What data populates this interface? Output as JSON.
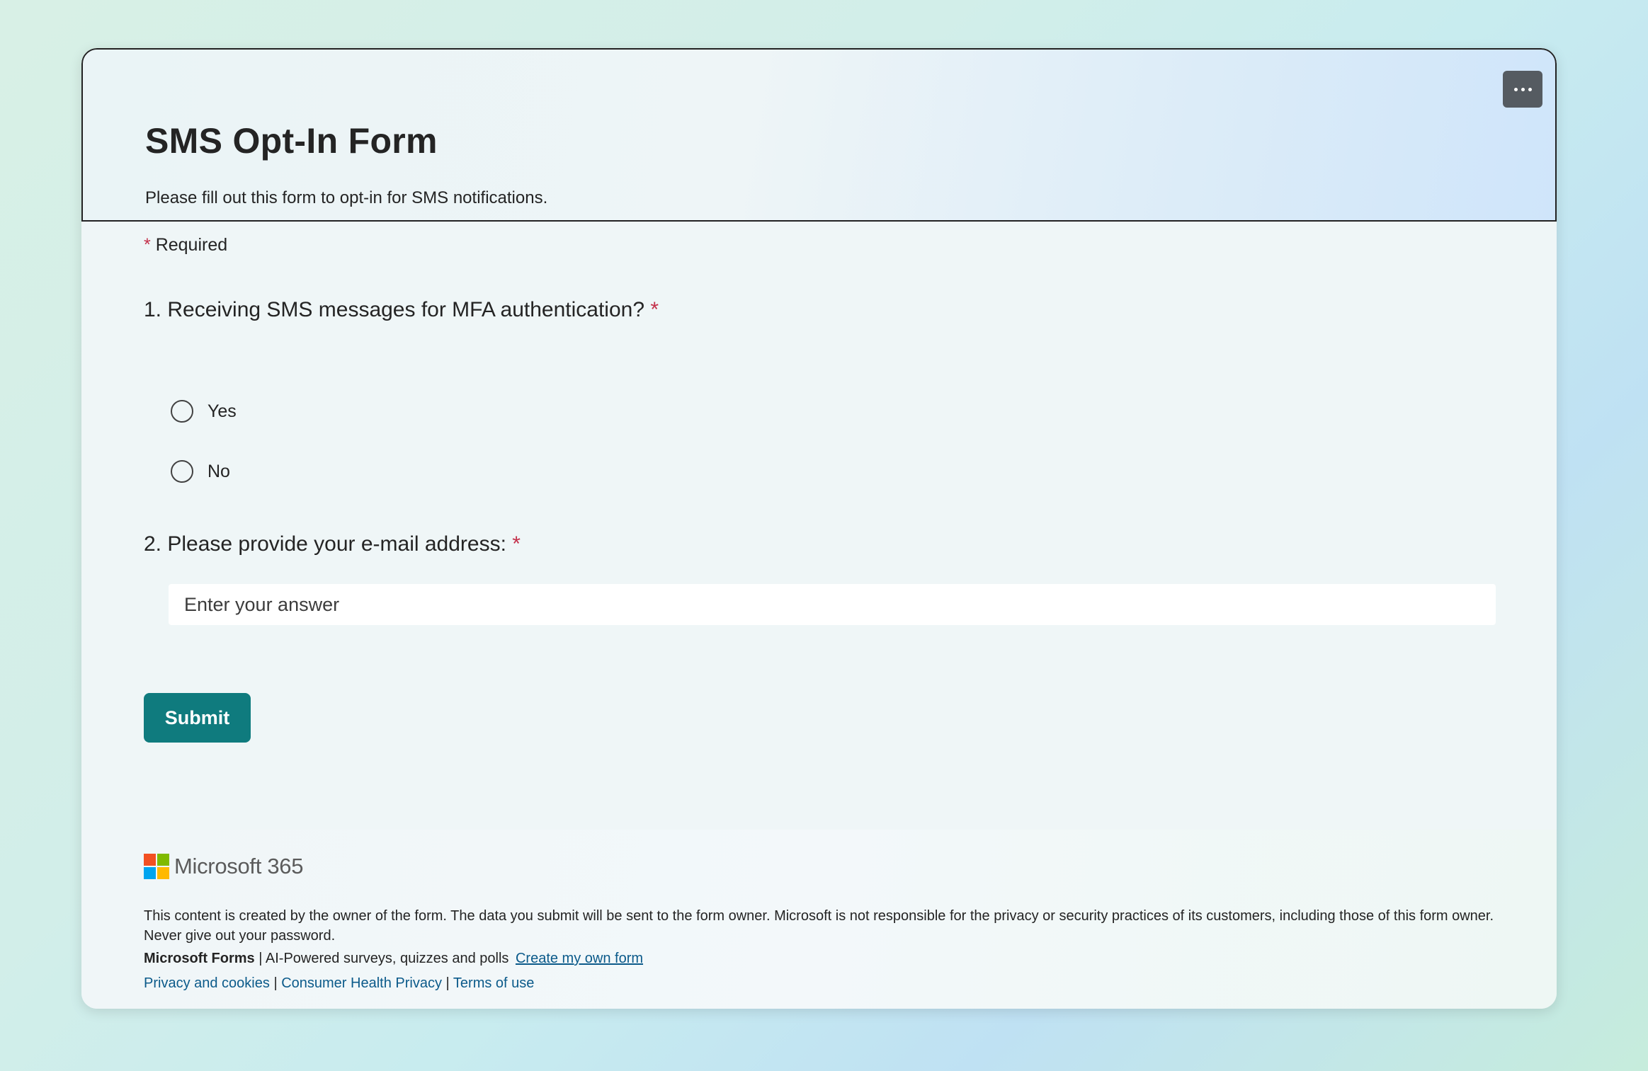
{
  "header": {
    "title": "SMS Opt-In Form",
    "description": "Please fill out this form to opt-in for SMS notifications.",
    "more_icon": "more-horizontal-icon"
  },
  "required_note": {
    "star": "*",
    "label": "Required"
  },
  "questions": [
    {
      "label": "1. Receiving SMS messages for MFA authentication?",
      "required_star": "*",
      "options": [
        {
          "label": "Yes"
        },
        {
          "label": "No"
        }
      ]
    },
    {
      "label": "2. Please provide your e-mail address:",
      "required_star": "*",
      "placeholder": "Enter your answer",
      "value": ""
    }
  ],
  "submit_label": "Submit",
  "footer": {
    "brand": "Microsoft 365",
    "logo_colors": [
      "#f25022",
      "#7fba00",
      "#00a4ef",
      "#ffb900"
    ],
    "disclaimer": "This content is created by the owner of the form. The data you submit will be sent to the form owner. Microsoft is not responsible for the privacy or security practices of its customers, including those of this form owner. Never give out your password.",
    "product_name": "Microsoft Forms",
    "separator": "|",
    "tagline": "AI-Powered surveys, quizzes and polls",
    "create_link": "Create my own form",
    "links": [
      "Privacy and cookies",
      "Consumer Health Privacy",
      "Terms of use"
    ]
  },
  "colors": {
    "accent": "#0f7b7e",
    "required": "#c4314b",
    "link": "#0b5a8a"
  }
}
